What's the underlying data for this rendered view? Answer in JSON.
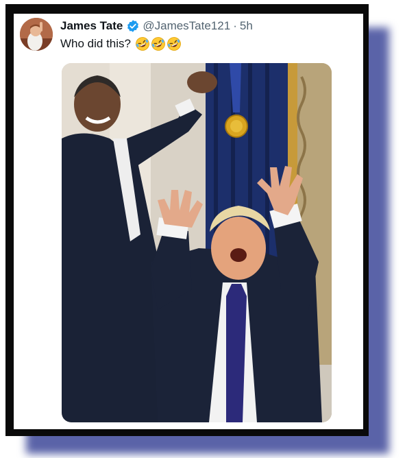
{
  "tweet": {
    "display_name": "James Tate",
    "verified_icon": "verified-badge-icon",
    "handle": "@JamesTate121",
    "separator": "·",
    "timestamp": "5h",
    "text": "Who did this?",
    "emojis": [
      "rofl-emoji-icon",
      "rofl-emoji-icon",
      "rofl-emoji-icon"
    ]
  },
  "colors": {
    "shadow": "#5a63a8",
    "frame": "#0a0a0a",
    "verified": "#1d9bf0",
    "text": "#0f1419",
    "muted": "#536471"
  }
}
